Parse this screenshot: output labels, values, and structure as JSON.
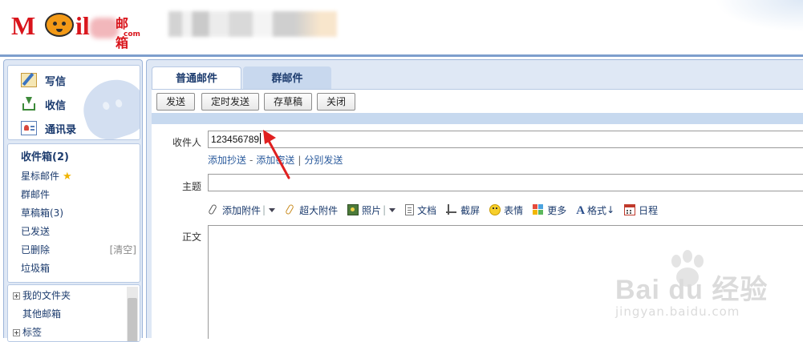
{
  "header": {
    "logo_mail": "M",
    "logo_il": "il",
    "logo_cn": "邮箱",
    "logo_com": "com"
  },
  "sidebar": {
    "quick": [
      {
        "label": "写信",
        "icon": "pen-icon"
      },
      {
        "label": "收信",
        "icon": "inbox-arrow-icon"
      },
      {
        "label": "通讯录",
        "icon": "contacts-icon"
      }
    ],
    "folders": [
      {
        "label": "收件箱(2)"
      },
      {
        "label": "星标邮件"
      },
      {
        "label": "群邮件"
      },
      {
        "label": "草稿箱(3)"
      },
      {
        "label": "已发送"
      },
      {
        "label": "已删除",
        "action": "[清空]"
      },
      {
        "label": "垃圾箱"
      }
    ],
    "my_folders": [
      {
        "label": "我的文件夹",
        "expandable": true
      },
      {
        "label": "其他邮箱",
        "expandable": false
      },
      {
        "label": "标签",
        "expandable": true
      }
    ]
  },
  "compose": {
    "tabs": [
      {
        "label": "普通邮件",
        "active": true
      },
      {
        "label": "群邮件",
        "active": false
      }
    ],
    "toolbar": {
      "send": "发送",
      "schedule_send": "定时发送",
      "save_draft": "存草稿",
      "close": "关闭"
    },
    "recipient_label": "收件人",
    "recipient_value": "123456789",
    "links": {
      "add_cc": "添加抄送",
      "add_bcc": "添加密送",
      "separate_send": "分别发送"
    },
    "subject_label": "主题",
    "subject_value": "",
    "attach_bar": {
      "add_attachment": "添加附件",
      "big_attachment": "超大附件",
      "photo": "照片",
      "document": "文档",
      "screenshot": "截屏",
      "emoji": "表情",
      "more": "更多",
      "format": "格式",
      "schedule": "日程"
    },
    "body_label": "正文",
    "body_value": ""
  },
  "watermark": {
    "brand": "Bai du 经验",
    "url": "jingyan.baidu.com"
  },
  "colors": {
    "brand_red": "#d9141b",
    "panel_bg": "#dfe8f5",
    "panel_border": "#9db5d9",
    "link": "#2a5a9c",
    "annotation_arrow": "#e02020"
  }
}
